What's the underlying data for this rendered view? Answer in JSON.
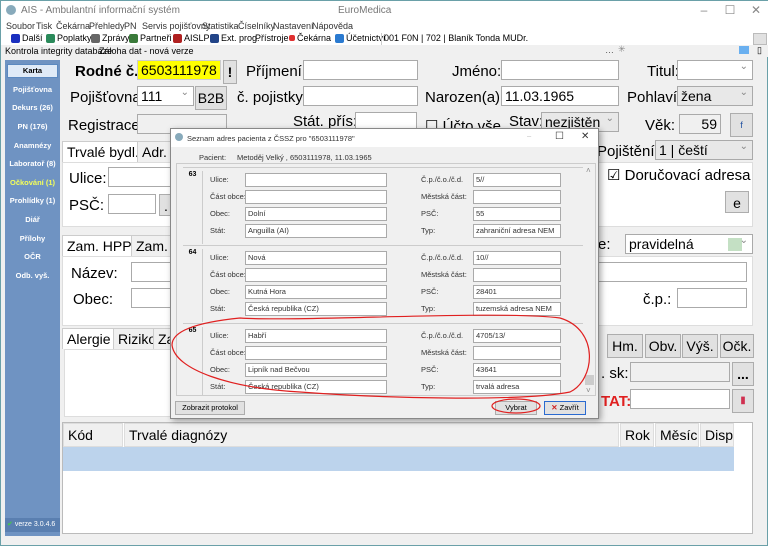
{
  "window": {
    "title": "AIS - Ambulantní informační systém",
    "company": "EuroMedica"
  },
  "menu": [
    "Soubor",
    "Tisk",
    "Čekárna",
    "Přehledy",
    "PN",
    "Servis pojišťovny",
    "Statistika",
    "Číselníky",
    "Nastavení",
    "Nápověda"
  ],
  "toolbar": {
    "items": [
      {
        "label": "Další",
        "icon": "arrow-icon",
        "color": "#1a2fbf"
      },
      {
        "label": "Poplatky",
        "icon": "people-icon",
        "color": "#2a8a5a"
      },
      {
        "label": "Zprávy",
        "icon": "document-icon",
        "color": "#666"
      },
      {
        "label": "Partneři",
        "icon": "partner-icon",
        "color": "#3a7a3a"
      },
      {
        "label": "AISLP",
        "icon": "aislp-icon",
        "color": "#b02020"
      },
      {
        "label": "Ext. prog.",
        "icon": "ext-program-icon",
        "color": "#224488"
      },
      {
        "label": "Přístroje",
        "icon": "",
        "color": ""
      },
      {
        "label": "Čekárna",
        "icon": "waiting-room-icon",
        "color": "#e03030"
      },
      {
        "label": "Účetnictví",
        "icon": "accounting-icon",
        "color": "#2a7ad0"
      }
    ],
    "doctor_field": "001   F0N | 702 | Blaník Tonda MUDr."
  },
  "row2": {
    "integrity": "Kontrola integrity databáze",
    "backup": "Záloha dat - nová verze"
  },
  "sidebar": {
    "items": [
      "Karta",
      "Pojišťovna",
      "Dekurs (26)",
      "PN (176)",
      "Anamnézy",
      "Laboratoř (8)",
      "Očkování (1)",
      "Prohlídky (1)",
      "Diář",
      "Přílohy",
      "OČR",
      "Odb. vyš."
    ],
    "version": "verze 3.0.4.6"
  },
  "patient": {
    "rodne_label": "Rodné č.:",
    "rodne": "6503111978",
    "excl": "!",
    "prijmeni_label": "Příjmení:",
    "jmeno_label": "Jméno:",
    "titul_label": "Titul:",
    "pojistovna_label": "Pojišťovna:",
    "pojistovna": "111",
    "b2b": "B2B",
    "cpojistky_label": "č. pojistky:",
    "narozen_label": "Narozen(a):",
    "narozen": "11.03.1965",
    "pohlavi_label": "Pohlaví:",
    "pohlavi": "žena",
    "registrace_label": "Registrace:",
    "stat_label": "Stát. přís:",
    "ucto_label": "Účto vše",
    "stav_label": "Stav:",
    "stav": "nezjištěn",
    "vek_label": "Věk:",
    "vek": "59",
    "pojisteni_label": "Pojištění:",
    "pojisteni": "1 | čeští",
    "addr_tabs": [
      "Trvalé bydl.",
      "Adr. s"
    ],
    "ulice_label": "Ulice:",
    "psc_label": "PSČ:",
    "dorucovaci": "Doručovací adresa",
    "e_btn": "e",
    "zam_tabs": [
      "Zam. HPP",
      "Zam. V"
    ],
    "nazev_label": "Název:",
    "obec_label": "Obec:",
    "prohl_suffix": "e:",
    "prohl": "pravidelná",
    "cp_label": "č.p.:",
    "med_tabs": [
      "Alergie",
      "Riziko",
      "Za"
    ],
    "meas_btns": [
      "Hm.",
      "Obv.",
      "Výš.",
      "Očk."
    ],
    "sk_label": ". sk:",
    "dots": "...",
    "tat_label": "TAT:",
    "diag_headers": [
      "Kód",
      "Trvalé diagnózy",
      "Rok",
      "Měsíc",
      "Disp"
    ]
  },
  "dialog": {
    "title": "Seznam adres pacienta z ČSSZ pro \"6503111978\"",
    "pacient_label": "Pacient:",
    "pacient": "Metoděj Velký , 6503111978, 11.03.1965",
    "labels": {
      "ulice": "Ulice:",
      "cast": "Část obce:",
      "obec": "Obec:",
      "stat": "Stát:",
      "cp": "Č.p./č.o./č.d.",
      "mestska": "Městská část:",
      "psc": "PSČ:",
      "typ": "Typ:"
    },
    "records": [
      {
        "num": "63",
        "ulice": "",
        "cast": "",
        "obec": "Dolní",
        "stat": "Anguilla (AI)",
        "cp": "5//",
        "mestska": "",
        "psc": "55",
        "typ": "zahraniční adresa NEM"
      },
      {
        "num": "64",
        "ulice": "Nová",
        "cast": "",
        "obec": "Kutná Hora",
        "stat": "Česká republika (CZ)",
        "cp": "10//",
        "mestska": "",
        "psc": "28401",
        "typ": "tuzemská adresa NEM"
      },
      {
        "num": "65",
        "ulice": "Habří",
        "cast": "",
        "obec": "Lipník nad Bečvou",
        "stat": "Česká republika (CZ)",
        "cp": "4705/13/",
        "mestska": "",
        "psc": "43641",
        "typ": "trvalá adresa"
      }
    ],
    "protokol": "Zobrazit protokol",
    "vybrat": "Vybrat",
    "zavrit": "Zavřít"
  },
  "colors": {
    "highlight": "#ffff00",
    "sidebar": "#6f93c2",
    "annotation": "#e02020",
    "tat": "#e02020",
    "selected_row": "#bcd3ec"
  }
}
